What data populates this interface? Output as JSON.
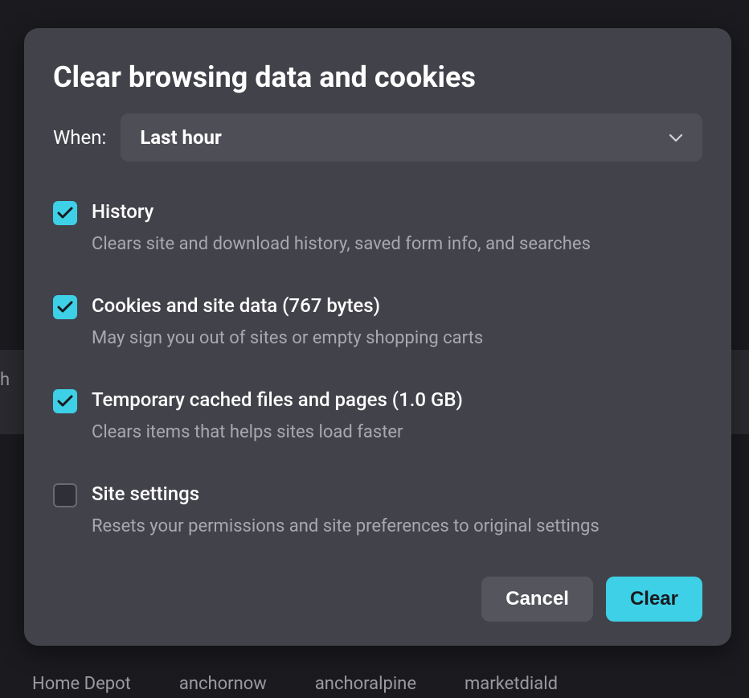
{
  "dialog": {
    "title": "Clear browsing data and cookies",
    "when_label": "When:",
    "when_value": "Last hour",
    "options": [
      {
        "title": "History",
        "desc": "Clears site and download history, saved form info, and searches",
        "checked": true
      },
      {
        "title": "Cookies and site data (767 bytes)",
        "desc": "May sign you out of sites or empty shopping carts",
        "checked": true
      },
      {
        "title": "Temporary cached files and pages (1.0 GB)",
        "desc": "Clears items that helps sites load faster",
        "checked": true
      },
      {
        "title": "Site settings",
        "desc": "Resets your permissions and site preferences to original settings",
        "checked": false
      }
    ],
    "cancel_label": "Cancel",
    "clear_label": "Clear"
  },
  "background": {
    "left_fragment": "h",
    "items": [
      "Home Depot",
      "anchornow",
      "anchoralpine",
      "marketdiald"
    ]
  }
}
